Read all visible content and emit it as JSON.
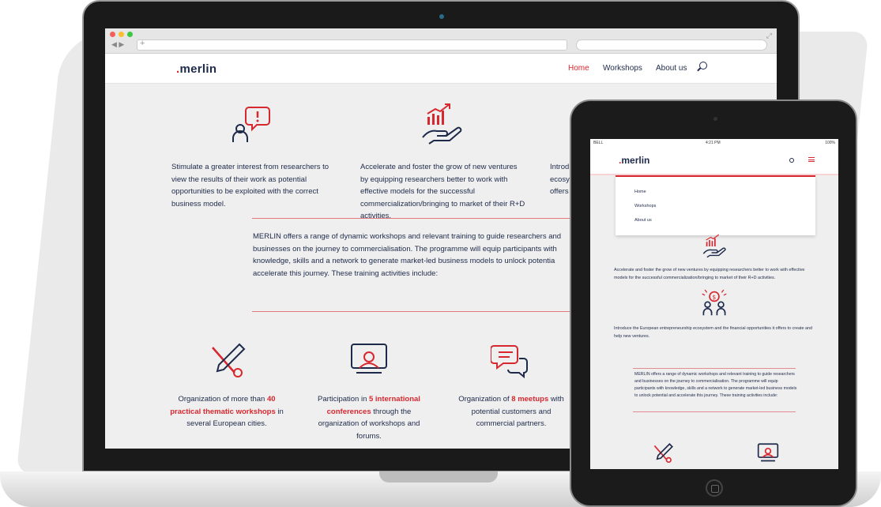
{
  "colors": {
    "accent": "#d7282f",
    "navy": "#1e2a4a",
    "screen_bg": "#efefef"
  },
  "laptop": {
    "header": {
      "logo": ".merlin",
      "nav": [
        "Home",
        "Workshops",
        "About us"
      ],
      "active": "Home",
      "search_icon": "search-icon"
    },
    "features": [
      {
        "icon": "person-speech-alert-icon",
        "text": "Stimulate a greater interest from researchers to view the results of their work as potential opportunities to be exploited with the correct business model."
      },
      {
        "icon": "hand-growth-chart-icon",
        "text": "Accelerate and foster the grow of new ventures by equipping researchers better to work with effective models for the successful commercialization/bringing to market of their R+D activities."
      },
      {
        "icon": "ecosystem-icon",
        "text": "Introd ecosy offers"
      }
    ],
    "intro": "MERLIN offers a range of dynamic workshops and relevant training to guide researchers and businesses on the journey to commercialisation. The programme will equip participants with knowledge, skills and a network to generate market-led business models to unlock potentia accelerate this journey. These training activities include:",
    "stats": [
      {
        "pre": "Organization of more than ",
        "highlight": "40 practical thematic workshops",
        "post": " in several European cities."
      },
      {
        "pre": "Participation in ",
        "highlight": "5 international conferences",
        "post": " through the organization of workshops and forums."
      },
      {
        "pre": "Organization of ",
        "highlight": "8 meetups",
        "post": " with potential customers and commercial partners."
      }
    ]
  },
  "tablet": {
    "status": {
      "carrier": "BELL",
      "time": "4:21 PM",
      "battery": "100%"
    },
    "logo": ".merlin",
    "menu": [
      "Home",
      "Workshops",
      "About us"
    ],
    "feature2": "Accelerate and foster the grow of new ventures by equipping researchers better to work with effective models for the successful commercialization/bringing to market of their R+D activities.",
    "feature3": "Introduce the European entrepreneurship ecosystem and the financial opportunities it offers to create and help new ventures.",
    "intro": "MERLIN offers a range of dynamic workshops and relevant training to guide researchers and businesses on the journey to commercialisation. The programme will equip participants with knowledge, skills and a network to generate market-led business models to unlock potential and accelerate this journey. These training activities include:"
  }
}
